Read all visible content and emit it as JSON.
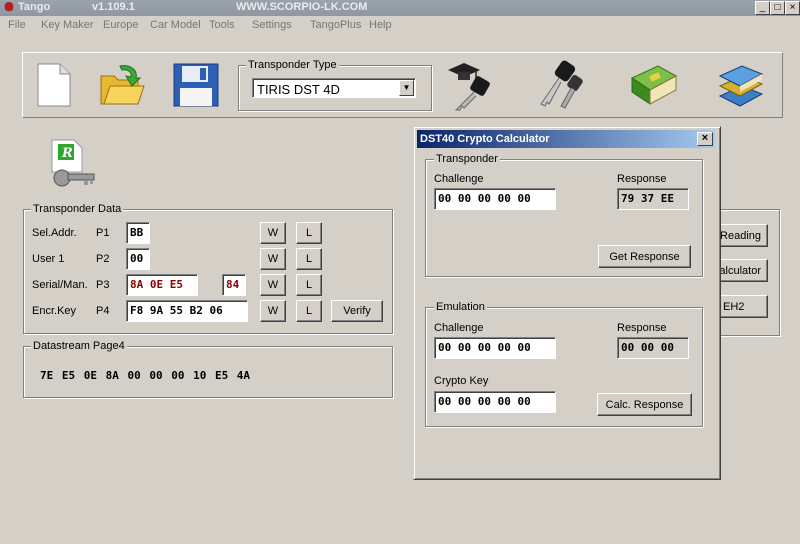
{
  "window": {
    "app_name": "Tango",
    "version": "v1.109.1",
    "website": "WWW.SCORPIO-LK.COM",
    "controls": [
      "_",
      "□",
      "×"
    ]
  },
  "menu": [
    "File",
    "Key Maker",
    "Europe",
    "Car Model",
    "Tools",
    "Settings",
    "TangoPlus",
    "Help"
  ],
  "toolbar": {
    "icons": [
      "new-file-icon",
      "open-folder-icon",
      "save-disk-icon",
      "graduation-key-icon",
      "car-keys-icon",
      "green-book-icon",
      "books-stack-icon"
    ],
    "transponder_type": {
      "title": "Transponder Type",
      "selected": "TIRIS DST 4D"
    }
  },
  "transponder_data": {
    "title": "Transponder Data",
    "rows": [
      {
        "label": "Sel.Addr.",
        "page": "P1",
        "value": "BB",
        "w": "W",
        "l": "L"
      },
      {
        "label": "User 1",
        "page": "P2",
        "value": "00",
        "w": "W",
        "l": "L"
      },
      {
        "label": "Serial/Man.",
        "page": "P3",
        "value": "8A 0E E5",
        "extra": "84",
        "w": "W",
        "l": "L"
      },
      {
        "label": "Encr.Key",
        "page": "P4",
        "value": "F8 9A 55 B2 06",
        "w": "W",
        "l": "L",
        "verify": "Verify"
      }
    ]
  },
  "datastream": {
    "title": "Datastream Page4",
    "value": "7E E5 0E 8A 00 00 00 10 E5 4A"
  },
  "right_panel_buttons": [
    "Reading",
    "alculator",
    "EH2"
  ],
  "dialog": {
    "title": "DST40 Crypto Calculator",
    "close": "×",
    "transponder": {
      "title": "Transponder",
      "challenge_label": "Challenge",
      "challenge": "00 00 00 00 00",
      "response_label": "Response",
      "response": "79 37 EE",
      "button": "Get Response"
    },
    "emulation": {
      "title": "Emulation",
      "challenge_label": "Challenge",
      "challenge": "00 00 00 00 00",
      "response_label": "Response",
      "response": "00 00 00",
      "crypto_key_label": "Crypto Key",
      "crypto_key": "00 00 00 00 00",
      "button": "Calc. Response"
    }
  }
}
